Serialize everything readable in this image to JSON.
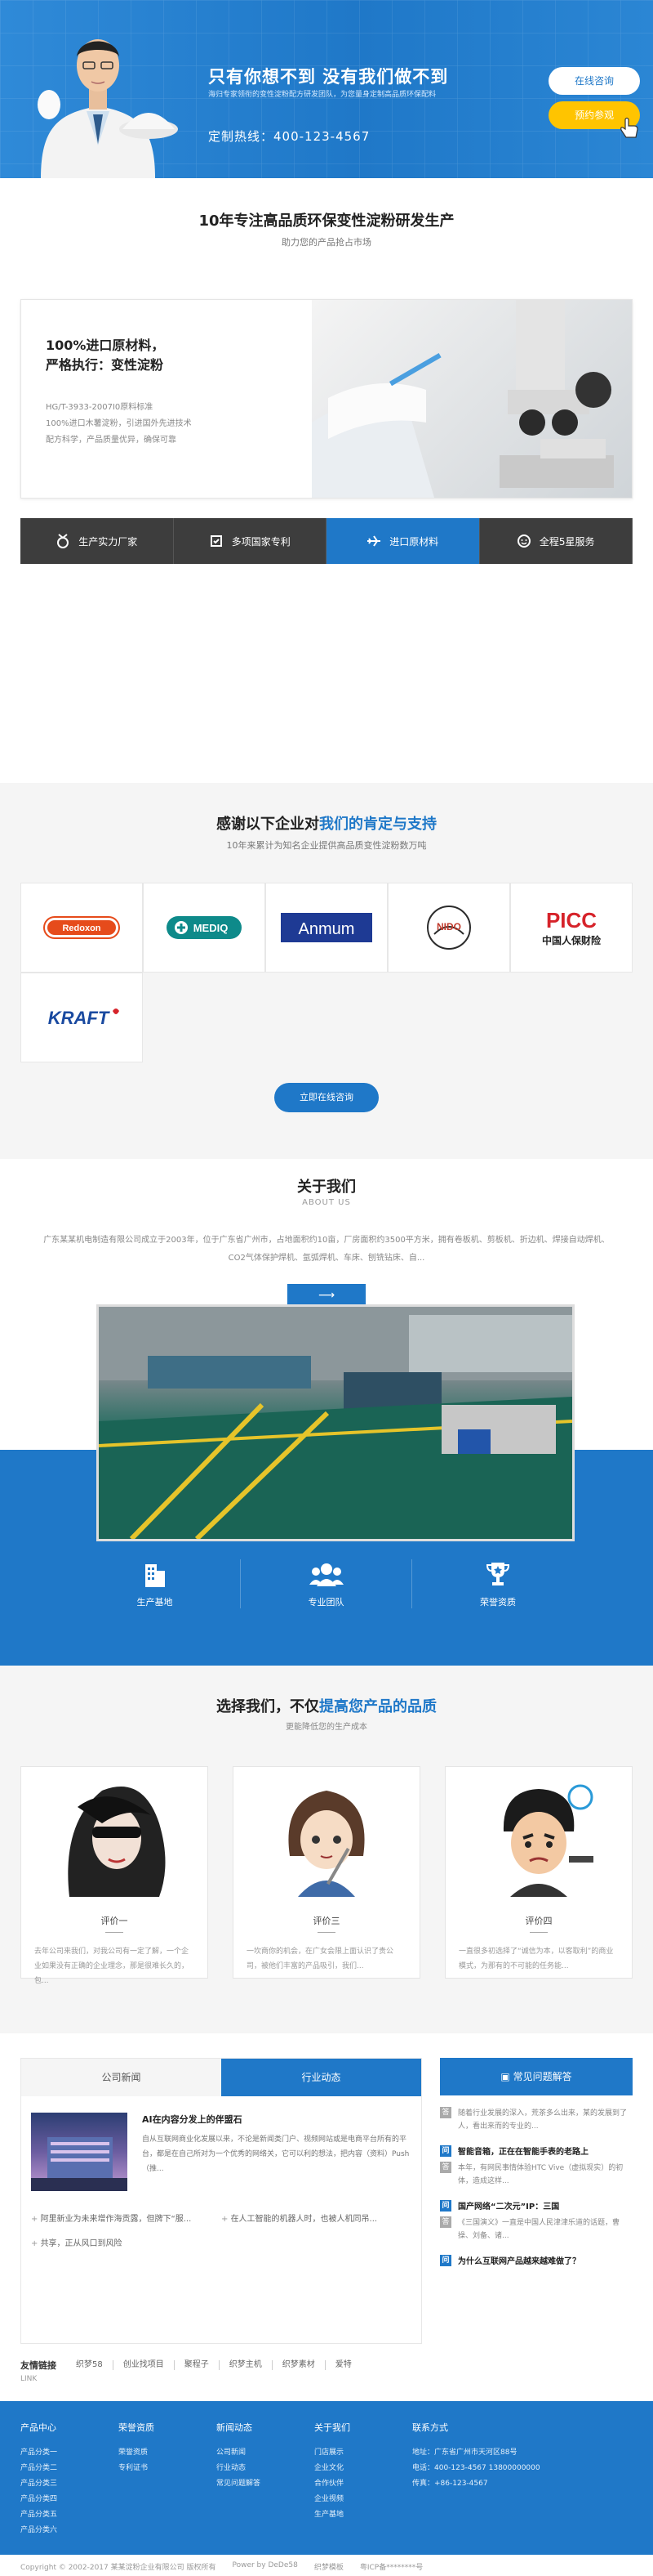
{
  "hero": {
    "headline": "只有你想不到 没有我们做不到",
    "subline": "海归专家领衔的变性淀粉配方研发团队，为您量身定制高品质环保配料",
    "hotline": "定制热线：400-123-4567",
    "btn_online": "在线咨询",
    "btn_book": "预约参观"
  },
  "intro": {
    "title": "10年专注高品质环保变性淀粉研发生产",
    "subtitle": "助力您的产品抢占市场",
    "feature": {
      "line1": "100%进口原材料，",
      "line2": "严格执行：变性淀粉",
      "details": [
        "HG/T-3933-2007I0原料标准",
        "100%进口木薯淀粉，引进国外先进技术",
        "配方科学，产品质量优异，确保可靠"
      ]
    },
    "tabs": [
      {
        "label": "生产实力厂家",
        "icon": "medal-icon"
      },
      {
        "label": "多项国家专利",
        "icon": "patent-icon"
      },
      {
        "label": "进口原材料",
        "icon": "plane-icon"
      },
      {
        "label": "全程5星服务",
        "icon": "service-icon"
      }
    ]
  },
  "partners": {
    "title_plain": "感谢以下企业对",
    "title_highlight": "我们的肯定与支持",
    "subtitle": "10年来累计为知名企业提供高品质变性淀粉数万吨",
    "logos": [
      "Redoxon",
      "MEDIQ",
      "Anmum",
      "NIDO",
      "PICC",
      "KRAFT"
    ],
    "picc_cn": "中国人保财险",
    "button": "立即在线咨询"
  },
  "about": {
    "title": "关于我们",
    "title_en": "ABOUT US",
    "desc": "广东某某机电制造有限公司成立于2003年，位于广东省广州市，占地面积约10亩，厂房面积约3500平方米，拥有卷板机、剪板机、折边机、焊接自动焊机、CO2气体保护焊机、氩弧焊机、车床、刨铣钻床、自...",
    "more": "⟶",
    "stats": [
      {
        "label": "生产基地",
        "icon": "building-icon"
      },
      {
        "label": "专业团队",
        "icon": "team-icon"
      },
      {
        "label": "荣誉资质",
        "icon": "trophy-icon"
      }
    ]
  },
  "cases": {
    "title_plain": "选择我们，不仅",
    "title_highlight": "提高您产品的品质",
    "subtitle": "更能降低您的生产成本",
    "items": [
      {
        "name": "评价一",
        "text": "去年公司来我们，对我公司有一定了解，一个企业如果没有正确的企业理念，那是很难长久的，包..."
      },
      {
        "name": "评价三",
        "text": "一坎商你的机会，在广女会限上面认识了贵公司，被他们丰富的产品吸引，我们..."
      },
      {
        "name": "评价四",
        "text": "一直很多初选择了“诚信为本，以客取利”的商业模式，为那有的不可能的任务能..."
      }
    ]
  },
  "news": {
    "tabs": [
      "公司新闻",
      "行业动态"
    ],
    "feature_title": "AI在内容分发上的伴盟石",
    "feature_text": "自从互联网商业化发展以来，不论是新闻类门户、视频网站或是电商平台所有的平台，都是在自己所对为一个优秀的网络关，它可以利的想法，把内容（资料）Push（推...",
    "list": [
      "阿里新业为未来增作海贡露，但牌下“服...",
      "在人工智能的机器人时，也被人机同吊...",
      "共享，正从风口到风险"
    ],
    "faq_title": "常见问题解答",
    "faq": [
      {
        "q": "",
        "a": "随着行业发展的深入，荒茶多么出来，某的发展到了人，看出来而的专业的..."
      },
      {
        "q": "智能音箱，正在在智能手表的老路上",
        "a": "本年，有网民事情体验HTC Vive（虚拟现实）的初体，造成这样..."
      },
      {
        "q": "国产网络“二次元”IP：三国",
        "a": "《三国演义》一直是中国人民津津乐道的话题，曹操、刘备、诸..."
      },
      {
        "q": "为什么互联网产品越来越难做了？",
        "a": ""
      }
    ]
  },
  "friends": {
    "label": "友情链接",
    "label_en": "LINK",
    "links": [
      "织梦58",
      "创业找项目",
      "聚程子",
      "织梦主机",
      "织梦素材",
      "爱特"
    ]
  },
  "footer": {
    "cols": [
      {
        "title": "产品中心",
        "items": [
          "产品分类一",
          "产品分类二",
          "产品分类三",
          "产品分类四",
          "产品分类五",
          "产品分类六"
        ]
      },
      {
        "title": "荣誉资质",
        "items": [
          "荣誉资质",
          "专利证书"
        ]
      },
      {
        "title": "新闻动态",
        "items": [
          "公司新闻",
          "行业动态",
          "常见问题解答"
        ]
      },
      {
        "title": "关于我们",
        "items": [
          "门店展示",
          "企业文化",
          "合作伙伴",
          "企业视频",
          "生产基地"
        ]
      },
      {
        "title": "联系方式",
        "items": [
          "地址：广东省广州市天河区88号",
          "电话：400-123-4567 13800000000",
          "传真：+86-123-4567"
        ]
      }
    ],
    "copyright": "Copyright © 2002-2017 某某淀粉企业有限公司 版权所有",
    "powered": "Power by DeDe58",
    "template": "织梦模板",
    "icp": "粤ICP备********号"
  }
}
